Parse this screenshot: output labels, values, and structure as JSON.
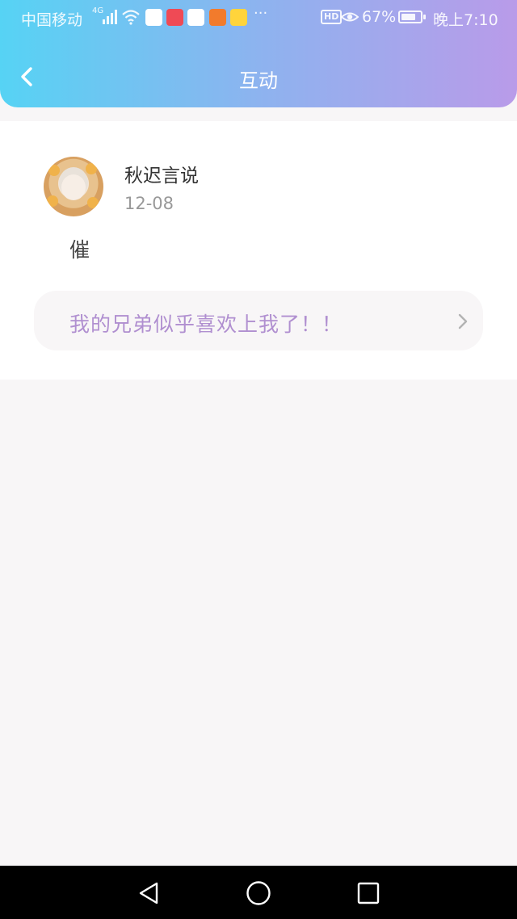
{
  "status_bar": {
    "carrier": "中国移动",
    "network": "4G",
    "battery_percent": "67%",
    "time": "晚上7:10",
    "hd_label": "HD",
    "more_indicator": "···",
    "app_icon_colors": [
      "#ffffff",
      "#ef4a55",
      "#ffffff",
      "#f27b2c",
      "#ffd43b"
    ]
  },
  "header": {
    "title": "互动",
    "back_icon": "chevron-left-icon"
  },
  "interaction": {
    "username": "秋迟言说",
    "date": "12-08",
    "comment": "催",
    "post_title": "我的兄弟似乎喜欢上我了！！",
    "post_chevron": "chevron-right-icon"
  },
  "navigation_bar": {
    "buttons": [
      "back-triangle-icon",
      "home-circle-icon",
      "recents-square-icon"
    ]
  },
  "colors": {
    "header_gradient_start": "#56d3f4",
    "header_gradient_end": "#b99be9",
    "post_title": "#b08fd0",
    "page_background": "#f8f6f7"
  }
}
